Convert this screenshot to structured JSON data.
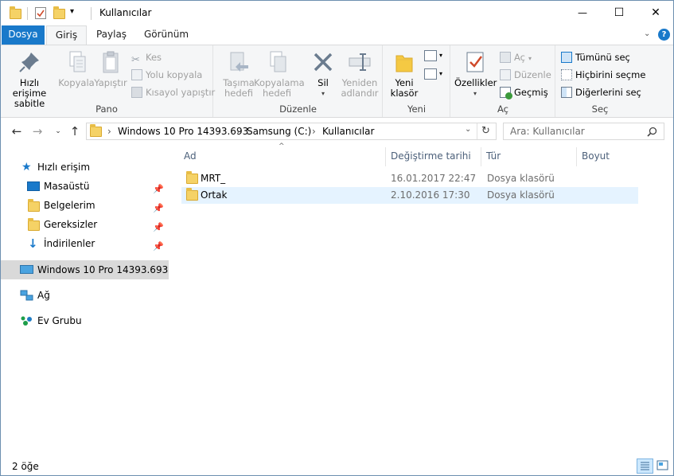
{
  "window": {
    "title": "Kullanıcılar",
    "minimize_glyph": "—",
    "maximize_glyph": "☐",
    "close_glyph": "✕"
  },
  "ribbon_tabs": {
    "file": "Dosya",
    "home": "Giriş",
    "share": "Paylaş",
    "view": "Görünüm"
  },
  "ribbon": {
    "clipboard": {
      "label": "Pano",
      "pin": "Hızlı erişime sabitle",
      "copy": "Kopyala",
      "paste": "Yapıştır",
      "cut": "Kes",
      "copy_path": "Yolu kopyala",
      "paste_shortcut": "Kısayol yapıştır"
    },
    "organize": {
      "label": "Düzenle",
      "move_to": "Taşıma hedefi",
      "copy_to": "Kopyalama hedefi",
      "delete": "Sil",
      "rename": "Yeniden adlandır"
    },
    "new": {
      "label": "Yeni",
      "new_folder": "Yeni klasör"
    },
    "open": {
      "label": "Aç",
      "properties": "Özellikler",
      "open": "Aç",
      "edit": "Düzenle",
      "history": "Geçmiş"
    },
    "select": {
      "label": "Seç",
      "select_all": "Tümünü seç",
      "select_none": "Hiçbirini seçme",
      "invert": "Diğerlerini seç"
    }
  },
  "address": {
    "crumbs": [
      "Windows 10 Pro 14393.693",
      "Samsung (C:)",
      "Kullanıcılar"
    ],
    "separator": "›"
  },
  "search": {
    "placeholder": "Ara: Kullanıcılar"
  },
  "nav": {
    "quick_access": "Hızlı erişim",
    "items": [
      {
        "label": "Masaüstü"
      },
      {
        "label": "Belgelerim"
      },
      {
        "label": "Gereksizler"
      },
      {
        "label": "İndirilenler"
      }
    ],
    "this_pc": "Windows 10 Pro 14393.693",
    "network": "Ağ",
    "homegroup": "Ev Grubu"
  },
  "columns": {
    "name": "Ad",
    "modified": "Değiştirme tarihi",
    "type": "Tür",
    "size": "Boyut"
  },
  "files": [
    {
      "name": "MRT_",
      "modified": "16.01.2017 22:47",
      "type": "Dosya klasörü",
      "size": ""
    },
    {
      "name": "Ortak",
      "modified": "2.10.2016 17:30",
      "type": "Dosya klasörü",
      "size": ""
    }
  ],
  "status": {
    "count": "2 öğe"
  },
  "colors": {
    "accent": "#1979ca",
    "selected_row": "#e5f3ff",
    "selected_nav": "#cce8ff",
    "folder": "#f5d266"
  }
}
